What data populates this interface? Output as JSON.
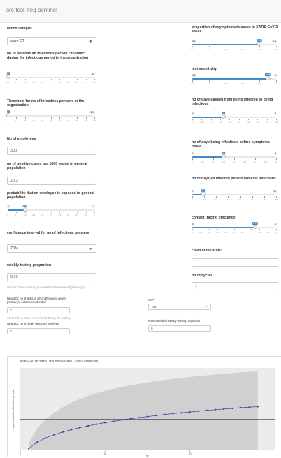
{
  "app": {
    "title": "src-test-freq-sentinel"
  },
  "left": {
    "campus": {
      "label": "which campus",
      "value": "save CT"
    },
    "infectees": {
      "label": "no of persons an infectious person can infect during the infectious period in the organization",
      "min": "0",
      "max": "10",
      "value": "0",
      "ticks": [
        "0.1",
        "0.5",
        "1.0",
        "1.5",
        "2.0",
        "2.5",
        "3.0",
        "3.5",
        "4.0",
        "4.5",
        "5.0"
      ]
    },
    "threshold": {
      "label": "Threshold for no of infectious persons in the organization",
      "min": "0",
      "max": "100",
      "value": "0",
      "ticks": [
        "0",
        "10",
        "20",
        "30",
        "40",
        "50",
        "60",
        "70",
        "80",
        "90",
        "100"
      ]
    },
    "employees": {
      "label": "No of employees",
      "value": "300"
    },
    "positives": {
      "label": "no of positive cases per 1000 tested in general population",
      "value": "20.3"
    },
    "exposure": {
      "label": "probability that an employee is exposed to general population",
      "min": "0",
      "max": "1",
      "value": "0.2",
      "ticks": [
        "0",
        "0.1",
        "0.2",
        "0.3",
        "0.4",
        "0.5",
        "0.6",
        "0.7",
        "0.8",
        "0.9",
        "1"
      ]
    },
    "ci": {
      "label": "confidence interval for no of infectious persons",
      "value": "70%"
    },
    "weekly": {
      "label": "weekly testing proportion",
      "value": "0.25"
    },
    "hint": "set to 0 if the testing prop will be determined by the App",
    "newtests": {
      "label": "New Ebt: no of tests in which the event recent positive(s) outcomes intended",
      "value": "0"
    },
    "note": "set to 0 if no cases were found during the testing",
    "newpos": {
      "label": "New Ebt: no of newly detected positives",
      "value": "0"
    }
  },
  "right": {
    "asympt": {
      "label": "proportion of asymptomatic cases in SARS-CoV-2 cases",
      "min": "0.1",
      "max": "0.6",
      "value": "0.5",
      "ticks": [
        "0.1",
        "0.2",
        "0.3",
        "0.4",
        "0.5",
        "0.6"
      ]
    },
    "sensitivity": {
      "label": "test sensitivity",
      "min": "0.5",
      "max": "1",
      "value": "0.95",
      "ticks": [
        "0.5",
        "0.6",
        "0.7",
        "0.8",
        "0.9",
        "1"
      ]
    },
    "daysinfect": {
      "label": "no of days passed from being infected to being infectious",
      "min": "0",
      "max": "8",
      "value": "3",
      "ticks": [
        "0",
        "0.8",
        "1.2",
        "1.6",
        "2.0",
        "2.4",
        "2.8",
        "3.2",
        "3.6",
        "4.0"
      ]
    },
    "onset": {
      "label": "no of days being infectious before symptoms onset",
      "min": "1",
      "max": "9",
      "value": "4",
      "ticks": [
        "1",
        "1.5",
        "2",
        "2.5",
        "3",
        "3.5",
        "4",
        "4.5",
        "5"
      ]
    },
    "remains": {
      "label": "no of days an infected person remains infectious",
      "min": "7",
      "max": "30",
      "value": "10",
      "ticks": [
        "7",
        "10",
        "13",
        "16",
        "19",
        "22",
        "25",
        "28"
      ]
    },
    "tracing": {
      "label": "contact tracing efficiency",
      "min": "0",
      "max": "1",
      "value": "0.75",
      "ticks": [
        "0",
        "0.1",
        "0.2",
        "0.3",
        "0.4",
        "0.5",
        "0.6",
        "0.7",
        "0.8",
        "0.9",
        "1"
      ]
    },
    "clean": {
      "label": "clean at the start?",
      "value": "1"
    },
    "cycles": {
      "label": "no of cycles",
      "value": "1"
    }
  },
  "mid": {
    "run": {
      "label": "run?",
      "value": "Yes"
    },
    "recommended": {
      "label": "recommended weekly testing proportion",
      "value": "0"
    }
  },
  "chart_data": {
    "type": "line",
    "title": "prop=0.25 (per week) | test every 28 days | 70% CI of total pos",
    "ylabel": "expected number of infectious persons",
    "xlabel": "w",
    "x": [
      1,
      2,
      3,
      4,
      5,
      6,
      7,
      8,
      9,
      10,
      11,
      12,
      13,
      14,
      15,
      16,
      17,
      18,
      19,
      20,
      21,
      22,
      23,
      24,
      25,
      26,
      27,
      28
    ],
    "series": [
      {
        "values": [
          0.2,
          0.9,
          1.35,
          1.7,
          2.0,
          2.25,
          2.47,
          2.67,
          2.85,
          3.02,
          3.17,
          3.31,
          3.45,
          3.57,
          3.69,
          3.8,
          3.91,
          4.01,
          4.1,
          4.19,
          4.28,
          4.36,
          4.44,
          4.51,
          4.58,
          4.65,
          4.71,
          4.77
        ]
      }
    ],
    "band_upper": [
      0.8,
      2.4,
      3.4,
      4.1,
      4.7,
      5.2,
      5.6,
      5.95,
      6.25,
      6.5,
      6.72,
      6.92,
      7.1,
      7.26,
      7.41,
      7.55,
      7.68,
      7.8,
      7.91,
      8.01,
      8.11,
      8.2,
      8.28,
      8.36,
      8.43,
      8.5,
      8.56,
      8.62
    ],
    "band_lower": [
      0,
      0,
      0,
      0,
      0,
      0,
      0,
      0,
      0,
      0,
      0,
      0,
      0,
      0,
      0,
      0,
      0,
      0,
      0,
      0,
      0,
      0,
      0,
      0,
      0,
      0,
      0,
      0
    ],
    "hline": 3.4,
    "xlim": [
      0,
      30
    ],
    "ylim": [
      0,
      9
    ],
    "xticks": [
      "0",
      "10",
      "20"
    ],
    "colors": {
      "line": "#2b3fa8",
      "band": "#d0d0d0",
      "hline": "#333333"
    }
  }
}
